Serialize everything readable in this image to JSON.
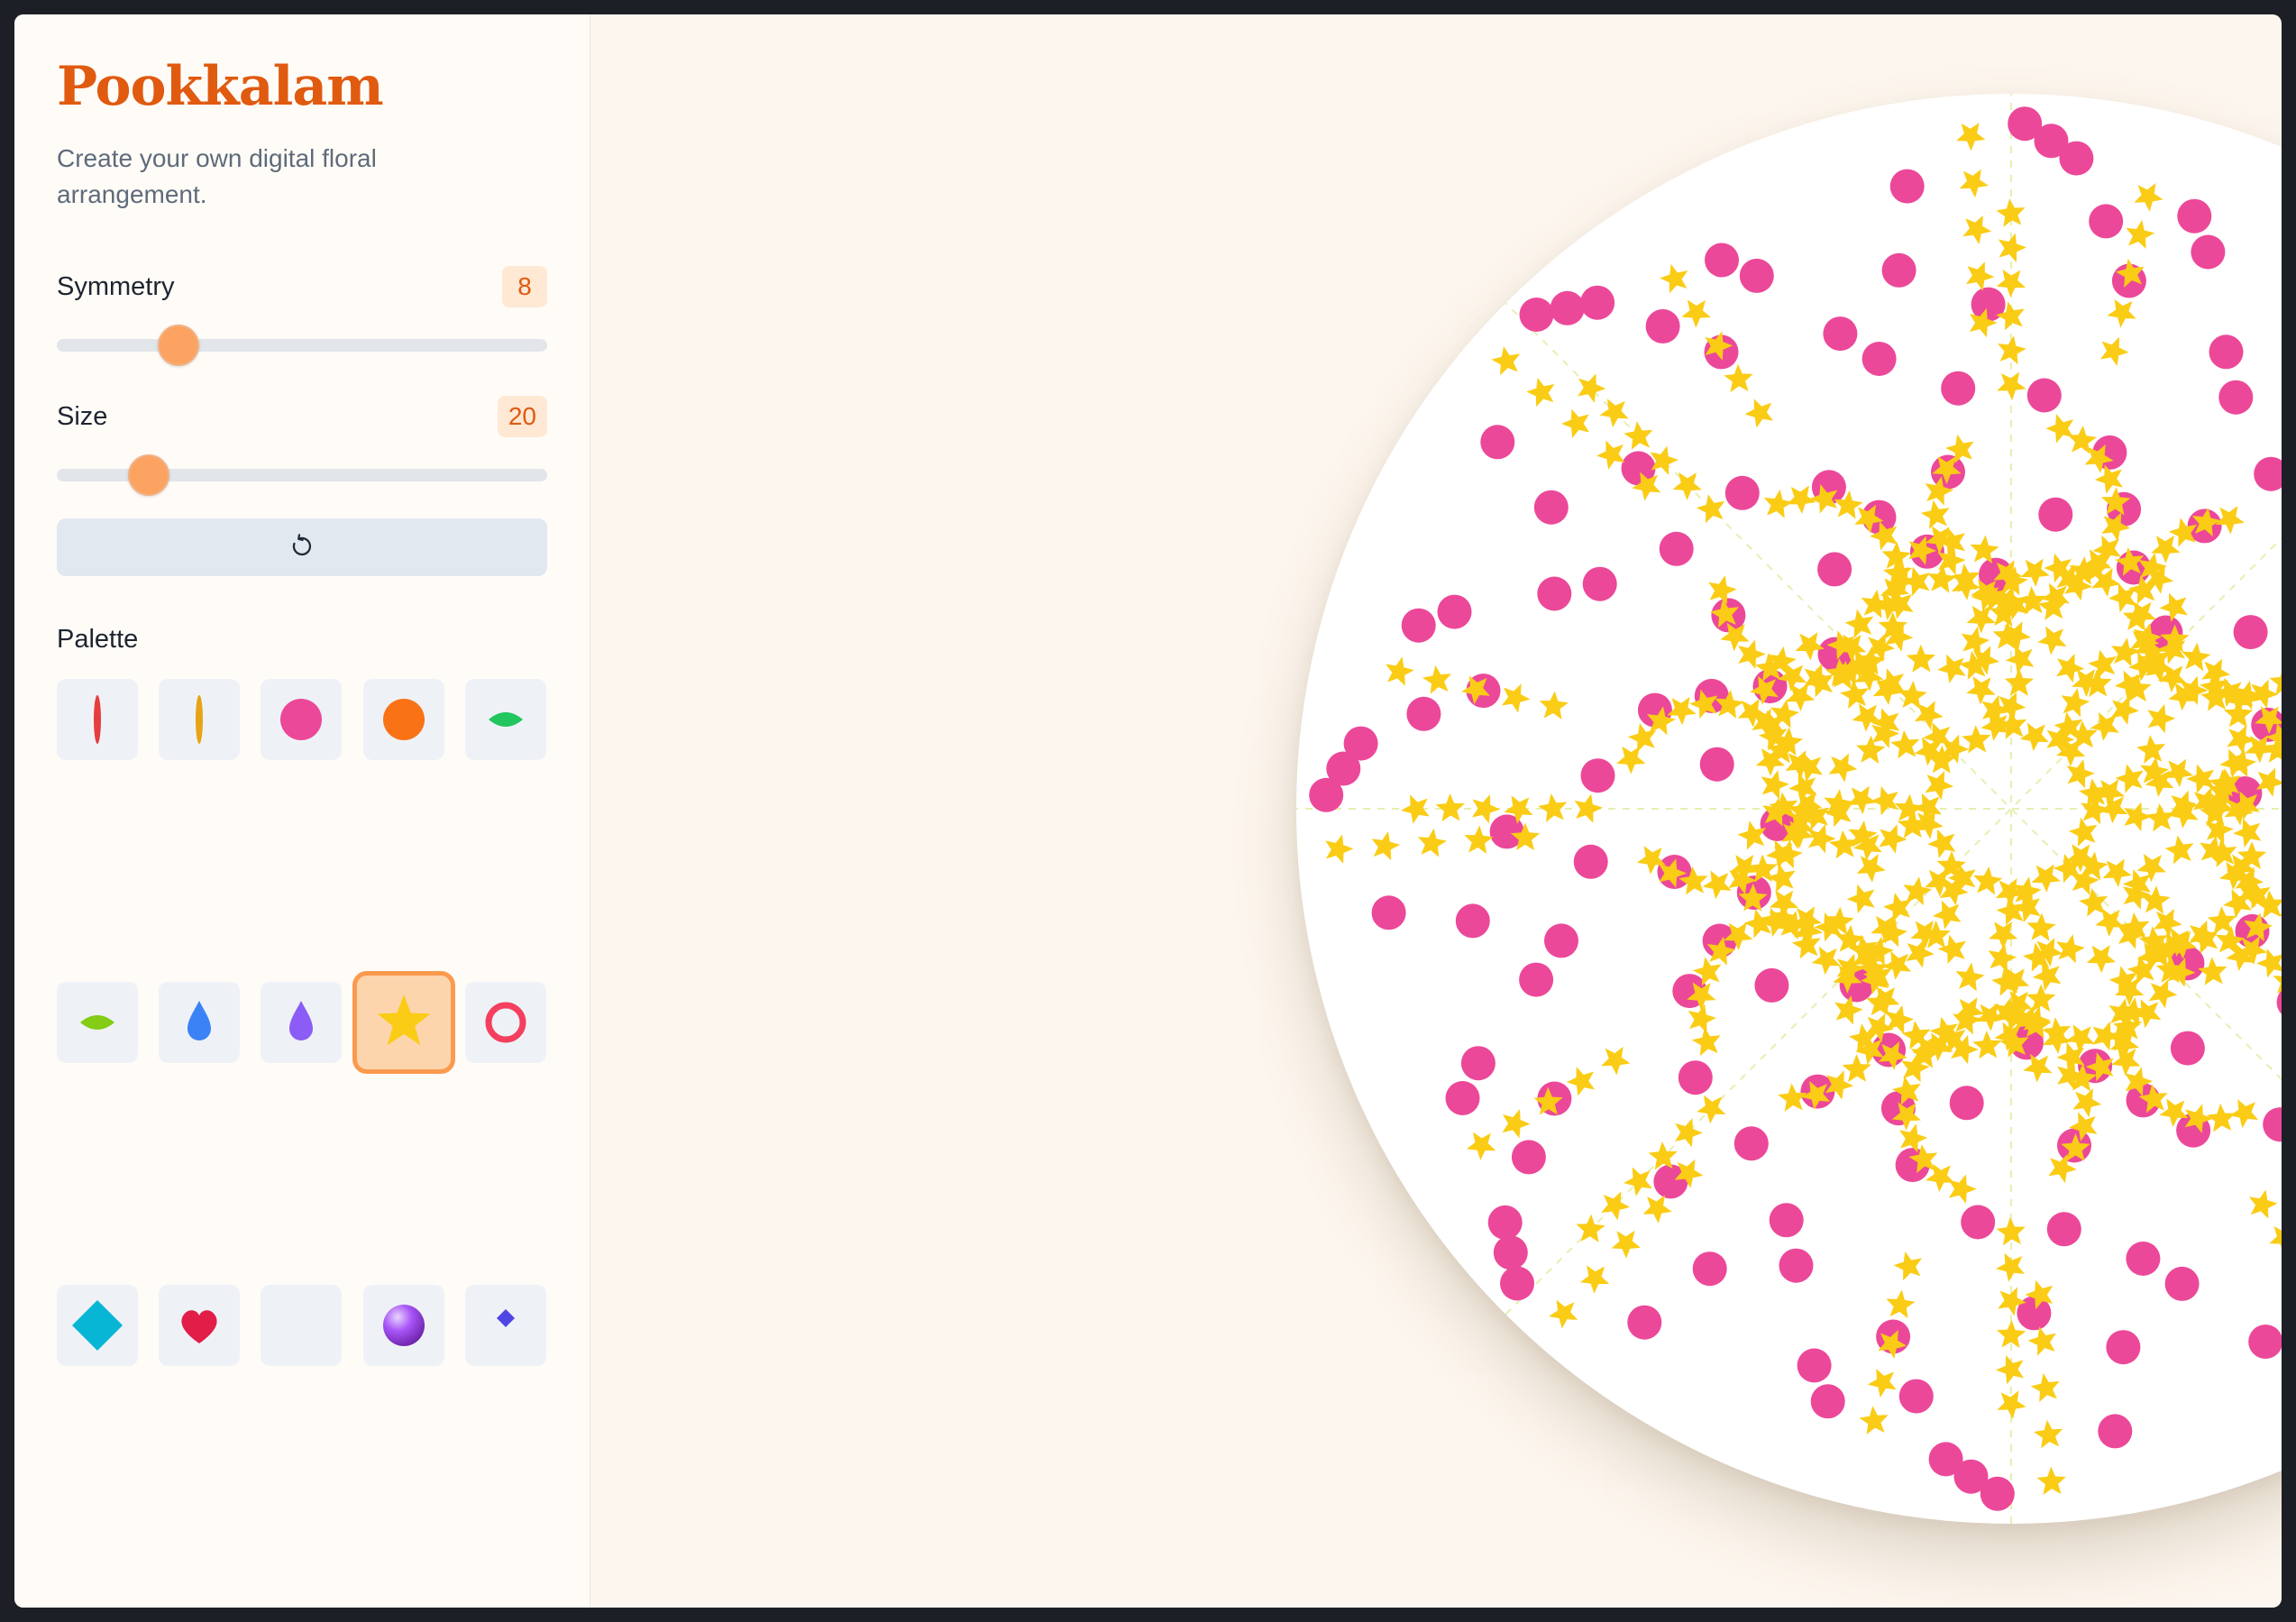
{
  "app": {
    "title": "Pookkalam",
    "subtitle": "Create your own digital floral arrangement."
  },
  "controls": {
    "symmetry": {
      "label": "Symmetry",
      "value": "8"
    },
    "size": {
      "label": "Size",
      "value": "20"
    },
    "reset_icon": "reset-icon"
  },
  "palette": {
    "label": "Palette",
    "selected": "star-petal",
    "items": [
      {
        "name": "red-petal",
        "color": "#e53e3e"
      },
      {
        "name": "orange-petal",
        "color": "#e8a317"
      },
      {
        "name": "pink-dot",
        "color": "#ec4899"
      },
      {
        "name": "orange-dot",
        "color": "#f97316"
      },
      {
        "name": "green-leaf",
        "color": "#22c55e"
      },
      {
        "name": "lime-leaf",
        "color": "#84cc16"
      },
      {
        "name": "blue-drop",
        "color": "#3b82f6"
      },
      {
        "name": "violet-drop",
        "color": "#8b5cf6"
      },
      {
        "name": "star-petal",
        "color": "#facc15"
      },
      {
        "name": "ring",
        "color": "#f43f5e"
      },
      {
        "name": "cyan-diamond",
        "color": "#06b6d4"
      },
      {
        "name": "heart",
        "color": "#e11d48"
      },
      {
        "name": "blank",
        "color": "#eef2f7"
      },
      {
        "name": "purple-bead",
        "color": "#9333ea"
      },
      {
        "name": "indigo-diamond",
        "color": "#4f46e5"
      }
    ]
  },
  "canvas": {
    "background": "#ffffff",
    "symmetry": 8,
    "guides": "dashed",
    "colors": {
      "star": "#facc15",
      "dot": "#ec4899",
      "guide": "#e6efb0"
    }
  }
}
